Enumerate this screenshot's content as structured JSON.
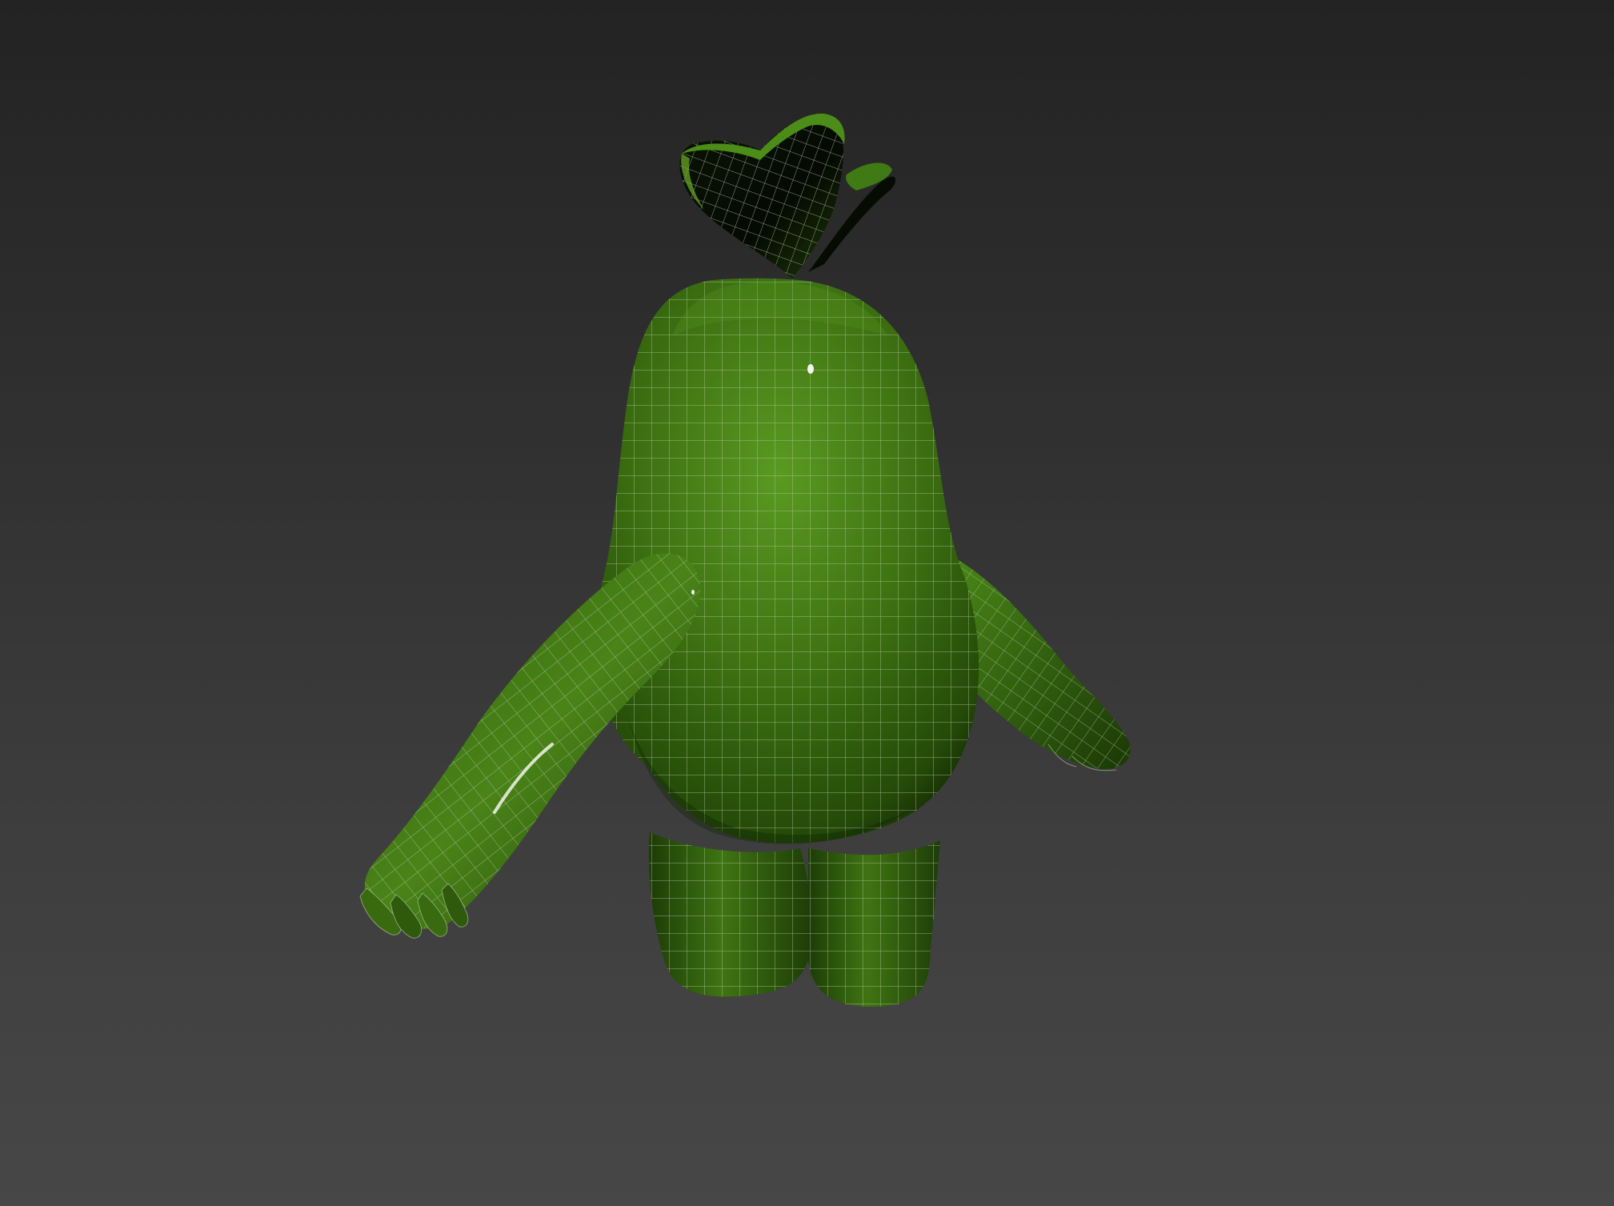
{
  "viewport": {
    "background_top": "#232323",
    "background_bottom": "#474747"
  },
  "model": {
    "name": "green-character-mesh",
    "shading": "smooth-with-wireframe",
    "body_color": "#3a6a10",
    "body_light_color": "#5a9a22",
    "body_dark_color": "#0f2104",
    "wire_color": "#b9c9a6",
    "highlight_color": "#f2f6ea"
  },
  "icons": {
    "leaf": "leaf-icon"
  }
}
